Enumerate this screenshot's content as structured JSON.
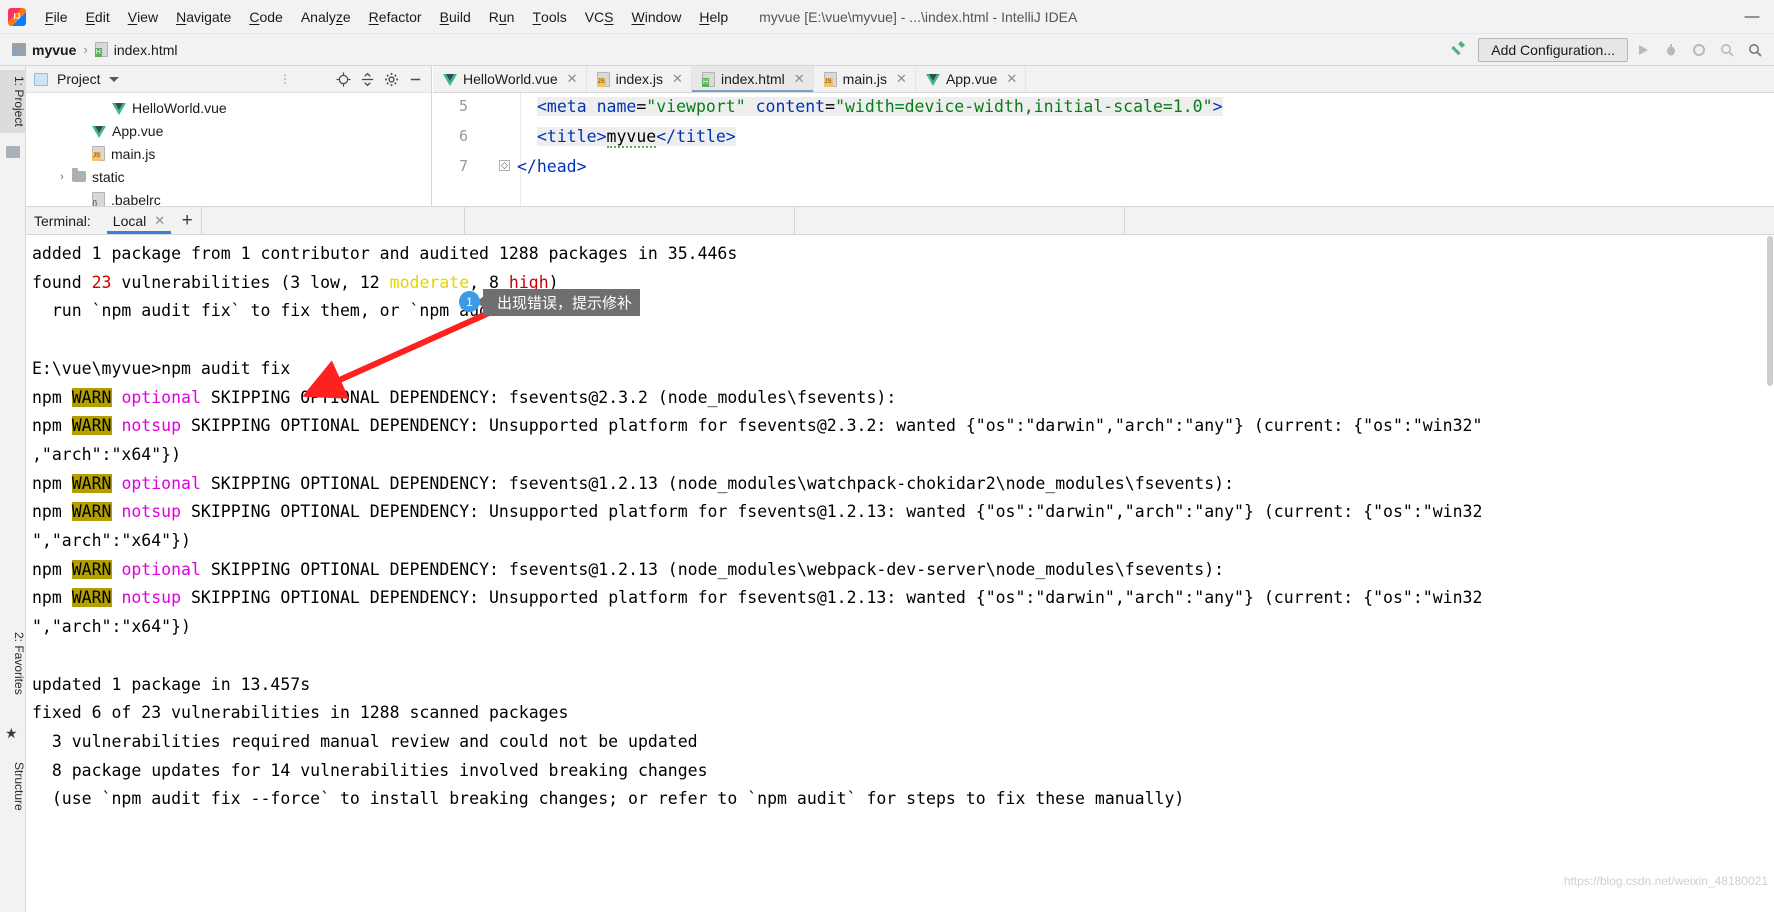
{
  "window": {
    "title": "myvue [E:\\vue\\myvue] - ...\\index.html - IntelliJ IDEA",
    "minimize": "—",
    "maximize": "❐",
    "close": "✕"
  },
  "menu": {
    "items": [
      {
        "label": "File",
        "mnemonic": "F"
      },
      {
        "label": "Edit",
        "mnemonic": "E"
      },
      {
        "label": "View",
        "mnemonic": "V"
      },
      {
        "label": "Navigate",
        "mnemonic": "N"
      },
      {
        "label": "Code",
        "mnemonic": "C"
      },
      {
        "label": "Analyze",
        "mnemonic": "z"
      },
      {
        "label": "Refactor",
        "mnemonic": "R"
      },
      {
        "label": "Build",
        "mnemonic": "B"
      },
      {
        "label": "Run",
        "mnemonic": "u"
      },
      {
        "label": "Tools",
        "mnemonic": "T"
      },
      {
        "label": "VCS",
        "mnemonic": "S"
      },
      {
        "label": "Window",
        "mnemonic": "W"
      },
      {
        "label": "Help",
        "mnemonic": "H"
      }
    ]
  },
  "breadcrumb": {
    "project": "myvue",
    "separator": "›",
    "file": "index.html"
  },
  "toolbar": {
    "add_configuration": "Add Configuration...",
    "hammer_icon": "build-hammer-icon",
    "run_icon": "run-icon",
    "debug_icon": "debug-icon",
    "coverage_icon": "coverage-icon",
    "profile_icon": "profile-icon",
    "search_icon": "search-icon"
  },
  "left_strip": {
    "project_tab": "1: Project",
    "favorites_tab": "2: Favorites",
    "structure_tab": "Structure"
  },
  "project_panel": {
    "title": "Project",
    "locate_icon": "locate-icon",
    "collapse_icon": "collapse-all-icon",
    "settings_icon": "gear-icon",
    "hide_icon": "hide-icon",
    "tree": [
      {
        "label": "HelloWorld.vue",
        "icon": "vue-file-icon",
        "indent": 3,
        "arrow": ""
      },
      {
        "label": "App.vue",
        "icon": "vue-file-icon",
        "indent": 2,
        "arrow": ""
      },
      {
        "label": "main.js",
        "icon": "js-file-icon",
        "indent": 2,
        "arrow": ""
      },
      {
        "label": "static",
        "icon": "folder-icon",
        "indent": 1,
        "arrow": "›"
      },
      {
        "label": ".babelrc",
        "icon": "babel-file-icon",
        "indent": 2,
        "arrow": ""
      }
    ]
  },
  "editor": {
    "tabs": [
      {
        "label": "HelloWorld.vue",
        "icon": "vue-file-icon",
        "active": false
      },
      {
        "label": "index.js",
        "icon": "js-file-icon",
        "active": false
      },
      {
        "label": "index.html",
        "icon": "html-file-icon",
        "active": true
      },
      {
        "label": "main.js",
        "icon": "js-file-icon",
        "active": false
      },
      {
        "label": "App.vue",
        "icon": "vue-file-icon",
        "active": false
      }
    ],
    "close_glyph": "✕",
    "lines": [
      {
        "number": "5",
        "fold": ""
      },
      {
        "number": "6",
        "fold": ""
      },
      {
        "number": "7",
        "fold": "◇"
      }
    ],
    "code": {
      "l5_a": "<meta ",
      "l5_b": "name",
      "l5_c": "=",
      "l5_d": "\"viewport\"",
      "l5_e": " content",
      "l5_f": "=",
      "l5_g": "\"width=device-width,initial-scale=1.0\"",
      "l5_h": ">",
      "l6_a": "<title>",
      "l6_b": "myvue",
      "l6_c": "</title>",
      "l7_a": "</head>"
    }
  },
  "terminal": {
    "label": "Terminal:",
    "tab": "Local",
    "close_glyph": "✕",
    "add_glyph": "+",
    "output": [
      {
        "id": "l1",
        "segments": [
          {
            "t": "added 1 package from 1 contributor and audited 1288 packages in 35.446s",
            "c": ""
          }
        ]
      },
      {
        "id": "l2",
        "segments": [
          {
            "t": "found ",
            "c": ""
          },
          {
            "t": "23",
            "c": "c-red"
          },
          {
            "t": " vulnerabilities (3 ",
            "c": ""
          },
          {
            "t": "low",
            "c": ""
          },
          {
            "t": ", 12 ",
            "c": ""
          },
          {
            "t": "moderate",
            "c": "c-yellow"
          },
          {
            "t": ", 8 ",
            "c": ""
          },
          {
            "t": "high",
            "c": "c-red"
          },
          {
            "t": ")",
            "c": ""
          }
        ]
      },
      {
        "id": "l3",
        "segments": [
          {
            "t": "  run `npm audit fix` to fix them, or `npm audit` for details",
            "c": ""
          }
        ]
      },
      {
        "id": "l4",
        "segments": [
          {
            "t": "",
            "c": ""
          }
        ]
      },
      {
        "id": "l5",
        "segments": [
          {
            "t": "E:\\vue\\myvue>npm audit fix",
            "c": ""
          }
        ]
      },
      {
        "id": "l6",
        "segments": [
          {
            "t": "npm ",
            "c": ""
          },
          {
            "t": "WARN",
            "c": "c-warn"
          },
          {
            "t": " ",
            "c": ""
          },
          {
            "t": "optional",
            "c": "c-magenta"
          },
          {
            "t": " SKIPPING OPTIONAL DEPENDENCY: fsevents@2.3.2 (node_modules\\fsevents):",
            "c": ""
          }
        ]
      },
      {
        "id": "l7",
        "segments": [
          {
            "t": "npm ",
            "c": ""
          },
          {
            "t": "WARN",
            "c": "c-warn"
          },
          {
            "t": " ",
            "c": ""
          },
          {
            "t": "notsup",
            "c": "c-magenta"
          },
          {
            "t": " SKIPPING OPTIONAL DEPENDENCY: Unsupported platform for fsevents@2.3.2: wanted {\"os\":\"darwin\",\"arch\":\"any\"} (current: {\"os\":\"win32\"",
            "c": ""
          }
        ]
      },
      {
        "id": "l8",
        "segments": [
          {
            "t": ",\"arch\":\"x64\"})",
            "c": ""
          }
        ]
      },
      {
        "id": "l9",
        "segments": [
          {
            "t": "npm ",
            "c": ""
          },
          {
            "t": "WARN",
            "c": "c-warn"
          },
          {
            "t": " ",
            "c": ""
          },
          {
            "t": "optional",
            "c": "c-magenta"
          },
          {
            "t": " SKIPPING OPTIONAL DEPENDENCY: fsevents@1.2.13 (node_modules\\watchpack-chokidar2\\node_modules\\fsevents):",
            "c": ""
          }
        ]
      },
      {
        "id": "l10",
        "segments": [
          {
            "t": "npm ",
            "c": ""
          },
          {
            "t": "WARN",
            "c": "c-warn"
          },
          {
            "t": " ",
            "c": ""
          },
          {
            "t": "notsup",
            "c": "c-magenta"
          },
          {
            "t": " SKIPPING OPTIONAL DEPENDENCY: Unsupported platform for fsevents@1.2.13: wanted {\"os\":\"darwin\",\"arch\":\"any\"} (current: {\"os\":\"win32",
            "c": ""
          }
        ]
      },
      {
        "id": "l11",
        "segments": [
          {
            "t": "\",\"arch\":\"x64\"})",
            "c": ""
          }
        ]
      },
      {
        "id": "l12",
        "segments": [
          {
            "t": "npm ",
            "c": ""
          },
          {
            "t": "WARN",
            "c": "c-warn"
          },
          {
            "t": " ",
            "c": ""
          },
          {
            "t": "optional",
            "c": "c-magenta"
          },
          {
            "t": " SKIPPING OPTIONAL DEPENDENCY: fsevents@1.2.13 (node_modules\\webpack-dev-server\\node_modules\\fsevents):",
            "c": ""
          }
        ]
      },
      {
        "id": "l13",
        "segments": [
          {
            "t": "npm ",
            "c": ""
          },
          {
            "t": "WARN",
            "c": "c-warn"
          },
          {
            "t": " ",
            "c": ""
          },
          {
            "t": "notsup",
            "c": "c-magenta"
          },
          {
            "t": " SKIPPING OPTIONAL DEPENDENCY: Unsupported platform for fsevents@1.2.13: wanted {\"os\":\"darwin\",\"arch\":\"any\"} (current: {\"os\":\"win32",
            "c": ""
          }
        ]
      },
      {
        "id": "l14",
        "segments": [
          {
            "t": "\",\"arch\":\"x64\"})",
            "c": ""
          }
        ]
      },
      {
        "id": "l15",
        "segments": [
          {
            "t": "",
            "c": ""
          }
        ]
      },
      {
        "id": "l16",
        "segments": [
          {
            "t": "updated 1 package in 13.457s",
            "c": ""
          }
        ]
      },
      {
        "id": "l17",
        "segments": [
          {
            "t": "fixed 6 of 23 vulnerabilities in 1288 scanned packages",
            "c": ""
          }
        ]
      },
      {
        "id": "l18",
        "segments": [
          {
            "t": "  3 vulnerabilities required manual review and could not be updated",
            "c": ""
          }
        ]
      },
      {
        "id": "l19",
        "segments": [
          {
            "t": "  8 package updates for 14 vulnerabilities involved breaking changes",
            "c": ""
          }
        ]
      },
      {
        "id": "l20",
        "segments": [
          {
            "t": "  (use `npm audit fix --force` to install breaking changes; or refer to `npm audit` for steps to fix these manually)",
            "c": ""
          }
        ]
      }
    ]
  },
  "annotation": {
    "badge": "1",
    "tooltip": "出现错误，提示修补",
    "arrow_color": "#ff2020"
  },
  "watermark": "https://blog.csdn.net/weixin_48180021",
  "colors": {
    "accent_blue": "#3a80d8",
    "badge_blue": "#3c9ae8",
    "warn_bg": "#b3a000",
    "magenta": "#e000e0",
    "red": "#cc0000",
    "yellow": "#e6d400",
    "vue_green": "#41b883",
    "string_green": "#067d17",
    "tag_blue": "#0033b3"
  }
}
